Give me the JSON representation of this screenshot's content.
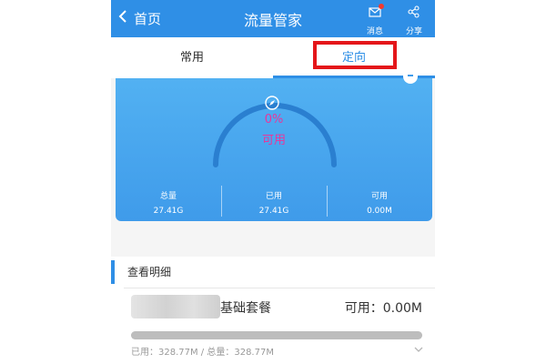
{
  "header": {
    "back_label": "首页",
    "title": "流量管家",
    "message_label": "消息",
    "share_label": "分享"
  },
  "tabs": [
    {
      "label": "常用",
      "active": false
    },
    {
      "label": "定向",
      "active": true
    }
  ],
  "gauge": {
    "percent": "0%",
    "label": "可用",
    "level": 0
  },
  "stats": [
    {
      "label": "总量",
      "value": "27.41G"
    },
    {
      "label": "已用",
      "value": "27.41G"
    },
    {
      "label": "可用",
      "value": "0.00M"
    }
  ],
  "details": {
    "heading": "查看明细",
    "package_name": "基础套餐",
    "available": "可用：0.00M",
    "usage": "已用：328.77M / 总量：328.77M",
    "progress": 1.0
  },
  "colors": {
    "primary": "#2f8fe6",
    "highlight": "#e4161a",
    "gauge_text": "#e8369b",
    "badge": "#f23a2f"
  },
  "icons": {
    "back": "chevron-left-icon",
    "message": "envelope-icon",
    "share": "share-icon",
    "gauge": "compass-icon",
    "expand": "chevron-down-icon"
  }
}
